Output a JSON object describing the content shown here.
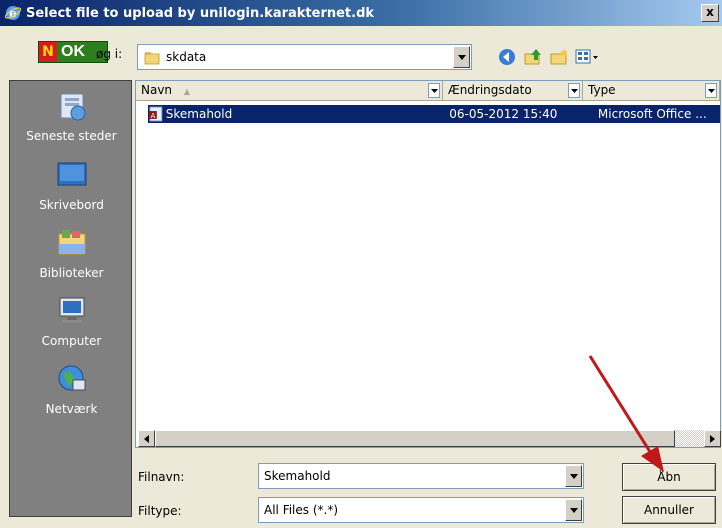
{
  "window": {
    "title": "Select file to upload by unilogin.karakternet.dk",
    "close_label": "x"
  },
  "lookin": {
    "logo_n": "N",
    "logo_ok": "OK",
    "label": "øg i:",
    "folder": "skdata"
  },
  "places": [
    {
      "label": "Seneste steder",
      "icon": "recent-places-icon"
    },
    {
      "label": "Skrivebord",
      "icon": "desktop-icon"
    },
    {
      "label": "Biblioteker",
      "icon": "libraries-icon"
    },
    {
      "label": "Computer",
      "icon": "computer-icon"
    },
    {
      "label": "Netværk",
      "icon": "network-icon"
    }
  ],
  "columns": {
    "name": "Navn",
    "date": "Ændringsdato",
    "type": "Type"
  },
  "files": [
    {
      "name": "Skemahold",
      "date": "06-05-2012 15:40",
      "type": "Microsoft Office ..."
    }
  ],
  "filename": {
    "label": "Filnavn:",
    "value": "Skemahold"
  },
  "filetype": {
    "label": "Filtype:",
    "value": "All Files (*.*)"
  },
  "buttons": {
    "open": "Åbn",
    "cancel": "Annuller"
  },
  "colors": {
    "selection": "#0a246a",
    "annotation_arrow": "#c0181a"
  }
}
